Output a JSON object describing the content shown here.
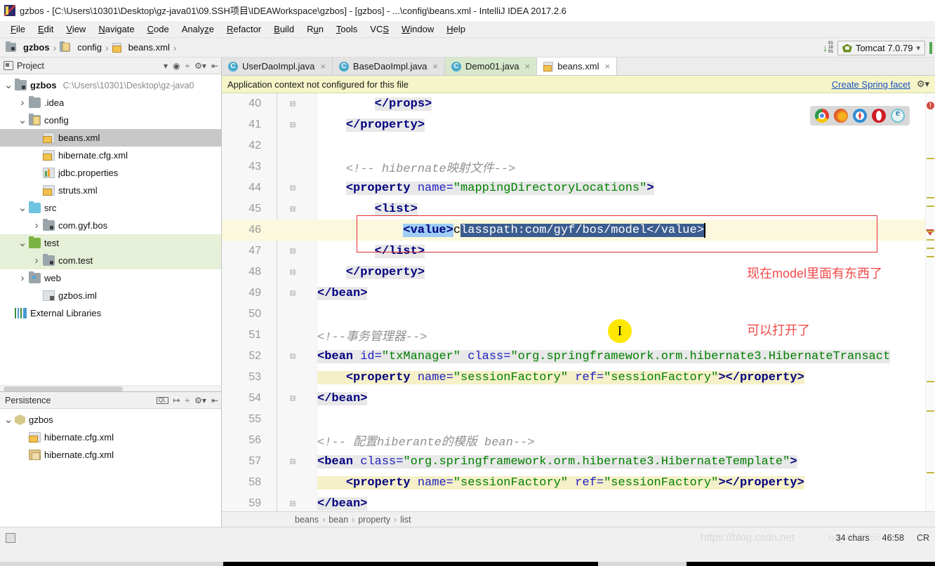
{
  "window": {
    "title": "gzbos - [C:\\Users\\10301\\Desktop\\gz-java01\\09.SSH项目\\IDEAWorkspace\\gzbos] - [gzbos] - ...\\config\\beans.xml - IntelliJ IDEA 2017.2.6"
  },
  "menu": {
    "items": [
      {
        "label": "File",
        "mnemonic": "F"
      },
      {
        "label": "Edit",
        "mnemonic": "E"
      },
      {
        "label": "View",
        "mnemonic": "V"
      },
      {
        "label": "Navigate",
        "mnemonic": "N"
      },
      {
        "label": "Code",
        "mnemonic": "C"
      },
      {
        "label": "Analyze",
        "mnemonic": "z"
      },
      {
        "label": "Refactor",
        "mnemonic": "R"
      },
      {
        "label": "Build",
        "mnemonic": "B"
      },
      {
        "label": "Run",
        "mnemonic": "u"
      },
      {
        "label": "Tools",
        "mnemonic": "T"
      },
      {
        "label": "VCS",
        "mnemonic": "S"
      },
      {
        "label": "Window",
        "mnemonic": "W"
      },
      {
        "label": "Help",
        "mnemonic": "H"
      }
    ]
  },
  "navbar": {
    "crumbs": [
      "gzbos",
      "config",
      "beans.xml"
    ],
    "run_config": "Tomcat 7.0.79"
  },
  "project_tool": {
    "title": "Project",
    "nodes": [
      {
        "label": "gzbos",
        "sub": "C:\\Users\\10301\\Desktop\\gz-java0",
        "indent": 0,
        "arrow": "v",
        "icon": "folder-module",
        "bold": true
      },
      {
        "label": ".idea",
        "sub": "",
        "indent": 1,
        "arrow": ">",
        "icon": "folder"
      },
      {
        "label": "config",
        "sub": "",
        "indent": 1,
        "arrow": "v",
        "icon": "folder-config"
      },
      {
        "label": "beans.xml",
        "sub": "",
        "indent": 2,
        "arrow": "",
        "icon": "xml-file",
        "selected": true
      },
      {
        "label": "hibernate.cfg.xml",
        "sub": "",
        "indent": 2,
        "arrow": "",
        "icon": "xml-file"
      },
      {
        "label": "jdbc.properties",
        "sub": "",
        "indent": 2,
        "arrow": "",
        "icon": "properties-file"
      },
      {
        "label": "struts.xml",
        "sub": "",
        "indent": 2,
        "arrow": "",
        "icon": "xml-file"
      },
      {
        "label": "src",
        "sub": "",
        "indent": 1,
        "arrow": "v",
        "icon": "folder-source"
      },
      {
        "label": "com.gyf.bos",
        "sub": "",
        "indent": 2,
        "arrow": ">",
        "icon": "folder-package"
      },
      {
        "label": "test",
        "sub": "",
        "indent": 1,
        "arrow": "v",
        "icon": "folder-test",
        "highlight": true
      },
      {
        "label": "com.test",
        "sub": "",
        "indent": 2,
        "arrow": ">",
        "icon": "folder-package",
        "highlight": true
      },
      {
        "label": "web",
        "sub": "",
        "indent": 1,
        "arrow": ">",
        "icon": "folder-web"
      },
      {
        "label": "gzbos.iml",
        "sub": "",
        "indent": 2,
        "arrow": "",
        "icon": "iml-file"
      },
      {
        "label": "External Libraries",
        "sub": "",
        "indent": 0,
        "arrow": "",
        "icon": "libraries"
      }
    ]
  },
  "persistence_tool": {
    "title": "Persistence",
    "nodes": [
      {
        "label": "gzbos",
        "indent": 0,
        "arrow": "v",
        "icon": "persistence-unit"
      },
      {
        "label": "hibernate.cfg.xml",
        "indent": 1,
        "arrow": "",
        "icon": "xml-file"
      },
      {
        "label": "hibernate.cfg.xml",
        "indent": 1,
        "arrow": "",
        "icon": "hibernate-folder"
      }
    ]
  },
  "editor": {
    "tabs": [
      {
        "label": "UserDaoImpl.java",
        "icon": "java-class-icon",
        "state": "inactive"
      },
      {
        "label": "BaseDaoImpl.java",
        "icon": "java-class-icon",
        "state": "inactive"
      },
      {
        "label": "Demo01.java",
        "icon": "java-class-icon",
        "state": "selected"
      },
      {
        "label": "beans.xml",
        "icon": "xml-file-icon",
        "state": "active"
      }
    ],
    "notification": {
      "message": "Application context not configured for this file",
      "action": "Create Spring facet"
    },
    "breadcrumb": [
      "beans",
      "bean",
      "property",
      "list"
    ],
    "selection_text": "classpath:com/gyf/bos/model",
    "code_lines": [
      {
        "n": 40,
        "fold": "-",
        "segments": [
          {
            "t": "        ",
            "c": "plain"
          },
          {
            "t": "</props>",
            "c": "tag",
            "bg": "hl"
          }
        ]
      },
      {
        "n": 41,
        "fold": "-",
        "segments": [
          {
            "t": "    ",
            "c": "plain"
          },
          {
            "t": "</property>",
            "c": "tag",
            "bg": "hl"
          }
        ]
      },
      {
        "n": 42,
        "fold": "",
        "segments": []
      },
      {
        "n": 43,
        "fold": "",
        "segments": [
          {
            "t": "    ",
            "c": "plain"
          },
          {
            "t": "<!-- hibernate映射文件-->",
            "c": "comment"
          }
        ]
      },
      {
        "n": 44,
        "fold": "-",
        "segments": [
          {
            "t": "    ",
            "c": "plain"
          },
          {
            "t": "<property ",
            "c": "tag",
            "bg": "hl"
          },
          {
            "t": "name=",
            "c": "attr",
            "bg": "hl"
          },
          {
            "t": "\"mappingDirectoryLocations\"",
            "c": "string",
            "bg": "hl"
          },
          {
            "t": ">",
            "c": "tag",
            "bg": "hl"
          }
        ]
      },
      {
        "n": 45,
        "fold": "-",
        "segments": [
          {
            "t": "        ",
            "c": "plain"
          },
          {
            "t": "<list>",
            "c": "tag",
            "bg": "hl"
          }
        ]
      },
      {
        "n": 46,
        "fold": "",
        "current": true,
        "segments": [
          {
            "t": "            ",
            "c": "plain"
          },
          {
            "t": "<value>",
            "c": "tag",
            "bg": "sel-light"
          },
          {
            "t": "c",
            "c": "plain"
          },
          {
            "t": "lasspath:com/gyf/bos/model</value>",
            "c": "plain",
            "bg": "sel-blue"
          }
        ]
      },
      {
        "n": 47,
        "fold": "-",
        "segments": [
          {
            "t": "        ",
            "c": "plain"
          },
          {
            "t": "</list>",
            "c": "tag",
            "bg": "hl"
          }
        ]
      },
      {
        "n": 48,
        "fold": "-",
        "segments": [
          {
            "t": "    ",
            "c": "plain"
          },
          {
            "t": "</property>",
            "c": "tag",
            "bg": "hl"
          }
        ]
      },
      {
        "n": 49,
        "fold": "-",
        "segments": [
          {
            "t": "",
            "c": "plain"
          },
          {
            "t": "</bean>",
            "c": "tag",
            "bg": "hl"
          }
        ]
      },
      {
        "n": 50,
        "fold": "",
        "segments": []
      },
      {
        "n": 51,
        "fold": "",
        "segments": [
          {
            "t": "",
            "c": "plain"
          },
          {
            "t": "<!--事务管理器-->",
            "c": "comment"
          }
        ]
      },
      {
        "n": 52,
        "fold": "-",
        "segments": [
          {
            "t": "<bean ",
            "c": "tag",
            "bg": "hl"
          },
          {
            "t": "id=",
            "c": "attr",
            "bg": "hl"
          },
          {
            "t": "\"txManager\"",
            "c": "string",
            "bg": "hl"
          },
          {
            "t": " ",
            "c": "plain",
            "bg": "hl"
          },
          {
            "t": "class=",
            "c": "attr",
            "bg": "hl"
          },
          {
            "t": "\"org.springframework.orm.hibernate3.HibernateTransact",
            "c": "string",
            "bg": "hl"
          }
        ]
      },
      {
        "n": 53,
        "fold": "",
        "segments": [
          {
            "t": "    ",
            "c": "plain",
            "bg": "yl"
          },
          {
            "t": "<property ",
            "c": "tag",
            "bg": "yl"
          },
          {
            "t": "name=",
            "c": "attr",
            "bg": "yl"
          },
          {
            "t": "\"sessionFactory\"",
            "c": "string",
            "bg": "yl"
          },
          {
            "t": " ",
            "c": "plain",
            "bg": "yl"
          },
          {
            "t": "ref=",
            "c": "attr",
            "bg": "yl"
          },
          {
            "t": "\"sessionFactory\"",
            "c": "string",
            "bg": "yl"
          },
          {
            "t": ">",
            "c": "tag",
            "bg": "yl"
          },
          {
            "t": "</property>",
            "c": "tag",
            "bg": "yl"
          }
        ]
      },
      {
        "n": 54,
        "fold": "-",
        "segments": [
          {
            "t": "",
            "c": "plain"
          },
          {
            "t": "</bean>",
            "c": "tag",
            "bg": "hl"
          }
        ]
      },
      {
        "n": 55,
        "fold": "",
        "segments": []
      },
      {
        "n": 56,
        "fold": "",
        "segments": [
          {
            "t": "",
            "c": "plain"
          },
          {
            "t": "<!-- 配置hiberante的模版 bean-->",
            "c": "comment"
          }
        ]
      },
      {
        "n": 57,
        "fold": "-",
        "segments": [
          {
            "t": "<bean ",
            "c": "tag",
            "bg": "hl"
          },
          {
            "t": "class=",
            "c": "attr",
            "bg": "hl"
          },
          {
            "t": "\"org.springframework.orm.hibernate3.HibernateTemplate\"",
            "c": "string",
            "bg": "hl"
          },
          {
            "t": ">",
            "c": "tag",
            "bg": "hl"
          }
        ]
      },
      {
        "n": 58,
        "fold": "",
        "segments": [
          {
            "t": "    ",
            "c": "plain",
            "bg": "yl"
          },
          {
            "t": "<property ",
            "c": "tag",
            "bg": "yl"
          },
          {
            "t": "name=",
            "c": "attr",
            "bg": "yl"
          },
          {
            "t": "\"sessionFactory\"",
            "c": "string",
            "bg": "yl"
          },
          {
            "t": " ",
            "c": "plain",
            "bg": "yl"
          },
          {
            "t": "ref=",
            "c": "attr",
            "bg": "yl"
          },
          {
            "t": "\"sessionFactory\"",
            "c": "string",
            "bg": "yl"
          },
          {
            "t": ">",
            "c": "tag",
            "bg": "yl"
          },
          {
            "t": "</property>",
            "c": "tag",
            "bg": "yl"
          }
        ]
      },
      {
        "n": 59,
        "fold": "-",
        "segments": [
          {
            "t": "",
            "c": "plain"
          },
          {
            "t": "</bean>",
            "c": "tag",
            "bg": "hl"
          }
        ]
      }
    ],
    "browsers": [
      "chrome-icon",
      "firefox-icon",
      "safari-icon",
      "opera-icon",
      "ie-icon"
    ]
  },
  "annotation": {
    "line1": "现在model里面有东西了",
    "line2": "可以打开了",
    "color": "#f04a4a"
  },
  "statusbar": {
    "chars": "34 chars",
    "position": "46:58",
    "line_sep": "CR",
    "watermark": "https://blog.csdn.net",
    "watermark2": "qq_41775840"
  },
  "colors": {
    "accent_blue": "#1a4fc4",
    "notif_bg": "#f5f5c8",
    "selection": "#3b5c8f",
    "annotation_red": "#f04a4a",
    "tab_active": "#d8e8cc"
  }
}
